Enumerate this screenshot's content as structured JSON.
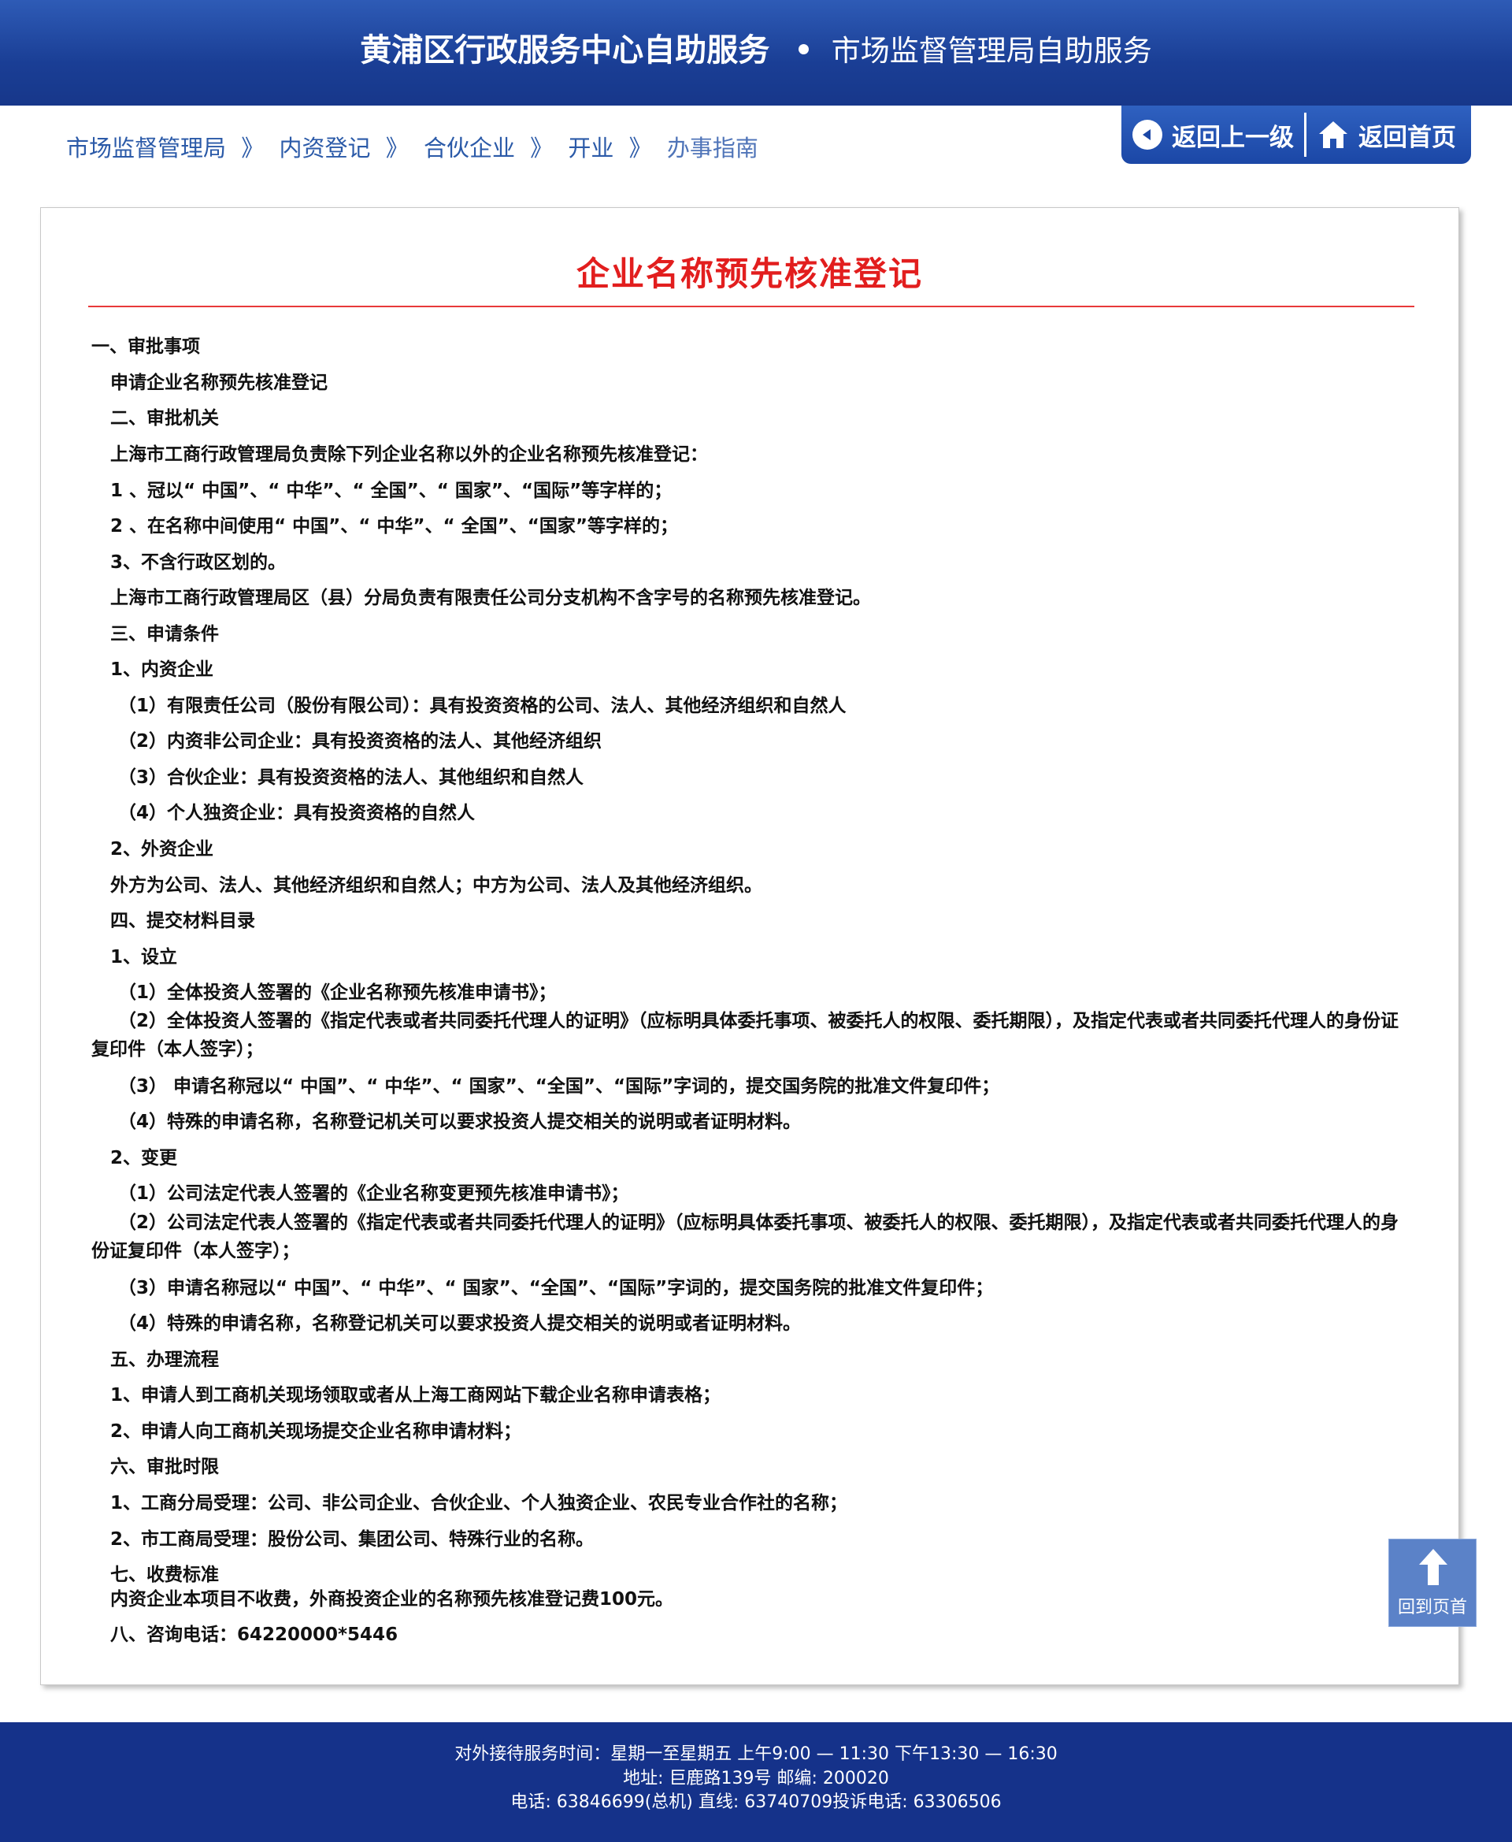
{
  "header": {
    "title": "黄浦区行政服务中心自助服务",
    "subtitle": "市场监督管理局自助服务"
  },
  "breadcrumb": {
    "items": [
      "市场监督管理局",
      "内资登记",
      "合伙企业",
      "开业",
      "办事指南"
    ],
    "separators": [
      "》",
      "》",
      "》",
      "》"
    ]
  },
  "nav": {
    "back_label": "返回上一级",
    "home_label": "返回首页"
  },
  "document": {
    "title": "企业名称预先核准登记",
    "lines": [
      "一、审批事项",
      "申请企业名称预先核准登记",
      "二、审批机关",
      "上海市工商行政管理局负责除下列企业名称以外的企业名称预先核准登记：",
      "1 、冠以“ 中国”、“ 中华”、“ 全国”、“ 国家”、“国际”等字样的；",
      "2 、在名称中间使用“ 中国”、“ 中华”、“ 全国”、“国家”等字样的；",
      "3、不含行政区划的。",
      "上海市工商行政管理局区（县）分局负责有限责任公司分支机构不含字号的名称预先核准登记。",
      "三、申请条件",
      "1、内资企业",
      "（1）有限责任公司（股份有限公司）：具有投资资格的公司、法人、其他经济组织和自然人",
      "（2）内资非公司企业：具有投资资格的法人、其他经济组织",
      "（3）合伙企业：具有投资资格的法人、其他组织和自然人",
      "（4）个人独资企业：具有投资资格的自然人",
      "2、外资企业",
      "外方为公司、法人、其他经济组织和自然人；中方为公司、法人及其他经济组织。",
      "四、提交材料目录",
      "1、设立",
      "（1）全体投资人签署的《企业名称预先核准申请书》；",
      "（2）全体投资人签署的《指定代表或者共同委托代理人的证明》（应标明具体委托事项、被委托人的权限、委托期限），及指定代表或者共同委托代理人的身份证复印件（本人签字）；",
      "（3） 申请名称冠以“ 中国”、“ 中华”、“ 国家”、“全国”、“国际”字词的，提交国务院的批准文件复印件；",
      "（4）特殊的申请名称，名称登记机关可以要求投资人提交相关的说明或者证明材料。",
      "2、变更",
      "（1）公司法定代表人签署的《企业名称变更预先核准申请书》；",
      "（2）公司法定代表人签署的《指定代表或者共同委托代理人的证明》（应标明具体委托事项、被委托人的权限、委托期限），及指定代表或者共同委托代理人的身份证复印件（本人签字）；",
      "（3）申请名称冠以“ 中国”、“ 中华”、“ 国家”、“全国”、“国际”字词的，提交国务院的批准文件复印件；",
      "（4）特殊的申请名称，名称登记机关可以要求投资人提交相关的说明或者证明材料。",
      "五、办理流程",
      "1、申请人到工商机关现场领取或者从上海工商网站下载企业名称申请表格；",
      "2、申请人向工商机关现场提交企业名称申请材料；",
      "六、审批时限",
      "1、工商分局受理：公司、非公司企业、合伙企业、个人独资企业、农民专业合作社的名称；",
      "2、市工商局受理：股份公司、集团公司、特殊行业的名称。",
      "七、收费标准",
      "内资企业本项目不收费，外商投资企业的名称预先核准登记费100元。",
      "八、咨询电话：64220000*5446"
    ]
  },
  "back_to_top": {
    "label": "回到页首"
  },
  "footer": {
    "hours": "对外接待服务时间：星期一至星期五 上午9:00 — 11:30 下午13:30 — 16:30",
    "address": "地址: 巨鹿路139号 邮编: 200020",
    "phones": "电话: 63846699(总机) 直线: 63740709投诉电话: 63306506"
  },
  "colors": {
    "header_blue": "#1a3e95",
    "title_red": "#e21e1e",
    "link_blue": "#2b5aa8",
    "footer_blue": "#15328a"
  }
}
